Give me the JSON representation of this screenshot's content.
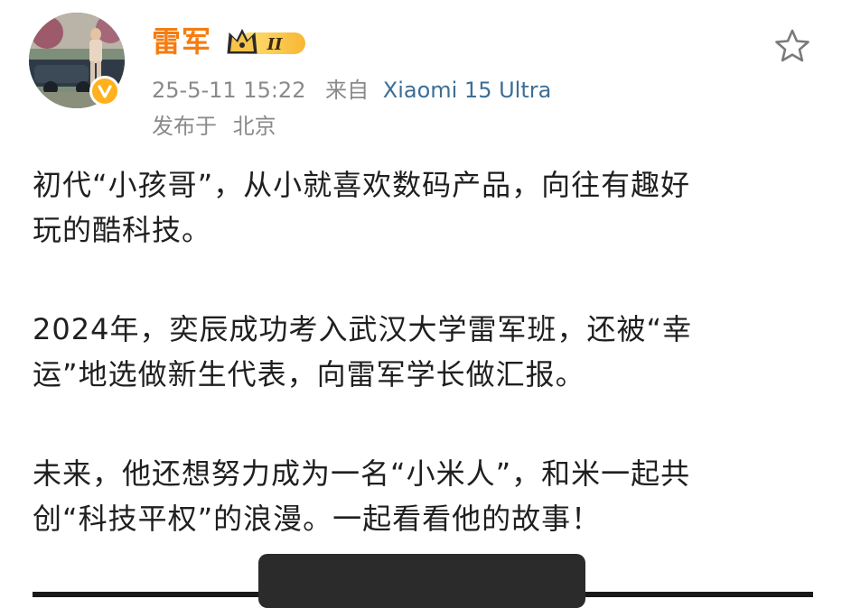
{
  "post": {
    "author": {
      "name": "雷军",
      "vip_level": "II",
      "verified": true
    },
    "timestamp": "25-5-11 15:22",
    "source_label": "来自",
    "source_device": "Xiaomi 15 Ultra",
    "location_label": "发布于",
    "location": "北京",
    "paragraphs": [
      {
        "lines": [
          "初代“小孩哥”，从小就喜欢数码产品，向往有趣好",
          "玩的酷科技。"
        ]
      },
      {
        "lines": [
          "2024年，奕辰成功考入武汉大学雷军班，还被“幸",
          "运”地选做新生代表，向雷军学长做汇报。"
        ]
      },
      {
        "lines": [
          "未来，他还想努力成为一名“小米人”，和米一起共",
          "创“科技平权”的浪漫。一起看看他的故事！"
        ]
      }
    ]
  },
  "icons": {
    "favorite": "star-outline-icon",
    "verified": "verified-badge-icon",
    "vip": "crown-vip-badge-icon"
  },
  "colors": {
    "username": "#f57c10",
    "meta_text": "#8a8a8a",
    "source_link": "#3c6e96",
    "verified_badge": "#ffb21e",
    "body_text": "#1f1f1f"
  }
}
